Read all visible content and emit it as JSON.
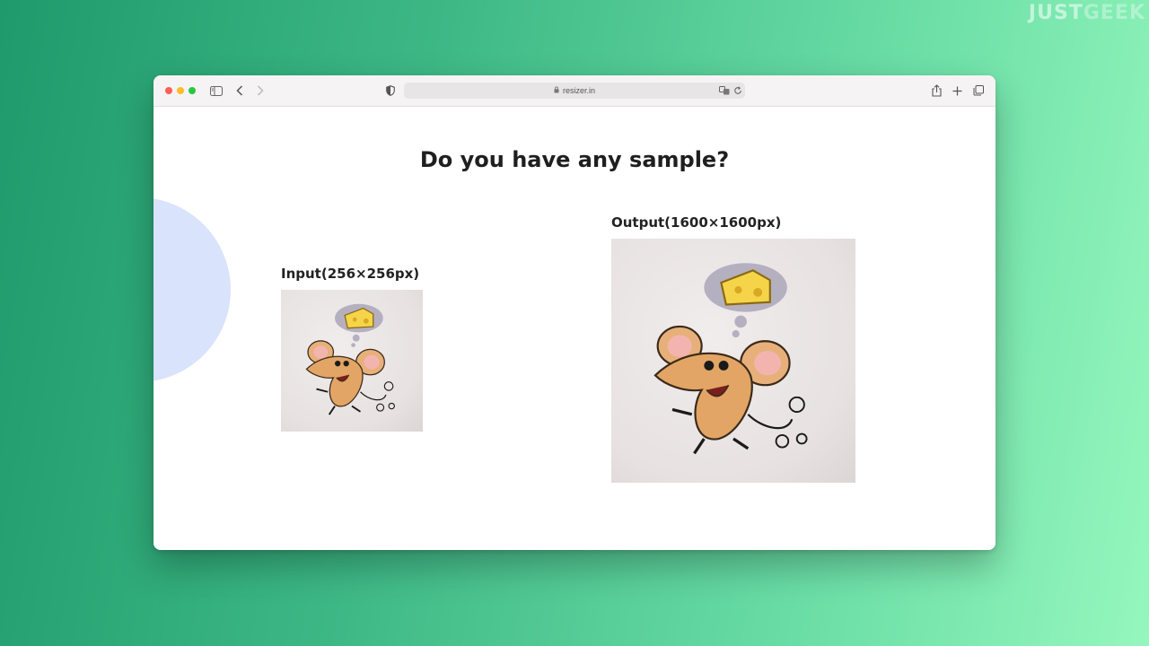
{
  "watermark": {
    "part1": "JUST",
    "part2": "GEEK"
  },
  "browser": {
    "url": "resizer.in",
    "traffic_lights": [
      "#fe5f57",
      "#febc2e",
      "#28c840"
    ]
  },
  "page": {
    "heading": "Do you have any sample?",
    "input_label": "Input(256×256px)",
    "output_label": "Output(1600×1600px)"
  },
  "images": {
    "input": {
      "description_icon": "mouse-dreaming-cheese-image-small"
    },
    "output": {
      "description_icon": "mouse-dreaming-cheese-image-large"
    }
  }
}
